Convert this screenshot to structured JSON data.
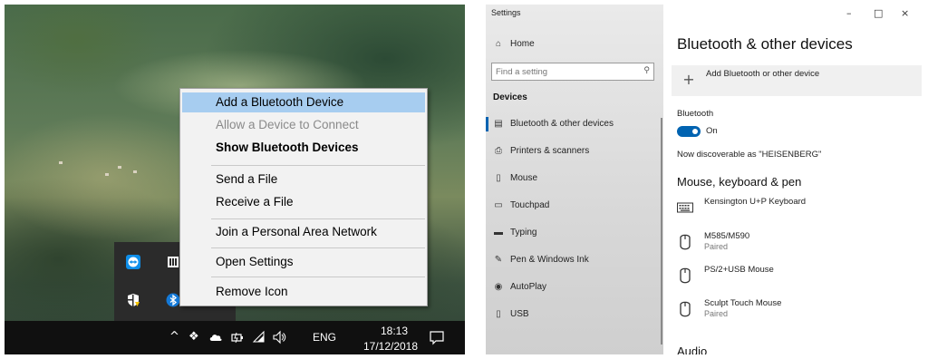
{
  "context_menu": {
    "items": [
      {
        "label": "Add a Bluetooth Device"
      },
      {
        "label": "Allow a Device to Connect"
      },
      {
        "label": "Show Bluetooth Devices"
      },
      {
        "label": "Send a File"
      },
      {
        "label": "Receive a File"
      },
      {
        "label": "Join a Personal Area Network"
      },
      {
        "label": "Open Settings"
      },
      {
        "label": "Remove Icon"
      }
    ]
  },
  "taskbar": {
    "chevron": "^",
    "language": "ENG",
    "time": "18:13",
    "date": "17/12/2018",
    "icons": [
      "chevron-up-icon",
      "dropbox-icon",
      "onedrive-icon",
      "battery-icon",
      "wifi-icon",
      "speaker-icon",
      "action-center-icon"
    ]
  },
  "tray_overflow": {
    "icons": [
      "teamviewer-icon",
      "app-icon",
      "security-shield-icon",
      "bluetooth-icon"
    ]
  },
  "settings": {
    "window_title": "Settings",
    "home_label": "Home",
    "search_placeholder": "Find a setting",
    "devices_heading": "Devices",
    "nav": [
      {
        "label": "Bluetooth & other devices",
        "icon": "bluetooth-devices-icon",
        "selected": true
      },
      {
        "label": "Printers & scanners",
        "icon": "printer-icon",
        "selected": false
      },
      {
        "label": "Mouse",
        "icon": "mouse-icon",
        "selected": false
      },
      {
        "label": "Touchpad",
        "icon": "touchpad-icon",
        "selected": false
      },
      {
        "label": "Typing",
        "icon": "keyboard-icon",
        "selected": false
      },
      {
        "label": "Pen & Windows Ink",
        "icon": "pen-icon",
        "selected": false
      },
      {
        "label": "AutoPlay",
        "icon": "autoplay-icon",
        "selected": false
      },
      {
        "label": "USB",
        "icon": "usb-icon",
        "selected": false
      }
    ],
    "window_controls": {
      "minimize": "–",
      "maximize": "□",
      "close": "×"
    },
    "page_title": "Bluetooth & other devices",
    "add_device_label": "Add Bluetooth or other device",
    "bluetooth_label": "Bluetooth",
    "bluetooth_state": "On",
    "discoverable_text": "Now discoverable as \"HEISENBERG\"",
    "section_mkp": "Mouse, keyboard & pen",
    "devices": [
      {
        "name": "Kensington U+P Keyboard",
        "status": "",
        "icon": "keyboard-icon"
      },
      {
        "name": "M585/M590",
        "status": "Paired",
        "icon": "mouse-icon"
      },
      {
        "name": "PS/2+USB Mouse",
        "status": "",
        "icon": "mouse-icon"
      },
      {
        "name": "Sculpt Touch Mouse",
        "status": "Paired",
        "icon": "mouse-icon"
      }
    ],
    "section_audio": "Audio",
    "accent_color": "#0063b1"
  }
}
